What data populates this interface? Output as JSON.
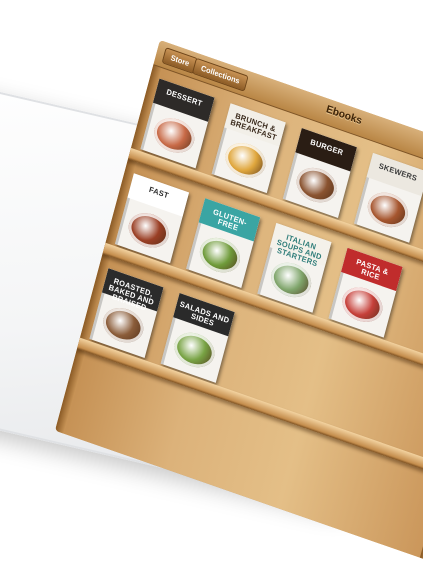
{
  "toolbar": {
    "store_label": "Store",
    "collections_label": "Collections",
    "title": "Ebooks"
  },
  "colors": {
    "wood_light": "#e4bf87",
    "wood_dark": "#8a5a25",
    "toolbar_button": "#8d5c26",
    "ipad_frame": "#f4f5f6"
  },
  "shelves": [
    {
      "books": [
        {
          "title": "DESSERT",
          "band": "#2d2a28",
          "ink": "#ffffff",
          "dish": "#c86a47"
        },
        {
          "title": "BRUNCH & BREAKFAST",
          "band": "#f2efe8",
          "ink": "#3a2a1c",
          "dish": "#e0a73d"
        },
        {
          "title": "BURGER",
          "band": "#2a1d14",
          "ink": "#ffffff",
          "dish": "#8a5330"
        },
        {
          "title": "SKEWERS",
          "band": "#ece8e0",
          "ink": "#3b3b3b",
          "dish": "#a6562f"
        }
      ]
    },
    {
      "books": [
        {
          "title": "FAST",
          "band": "#ffffff",
          "ink": "#2b2b2b",
          "dish": "#9a3f25"
        },
        {
          "title": "GLUTEN-FREE",
          "band": "#3aa5a3",
          "ink": "#ffffff",
          "dish": "#6f9b3a"
        },
        {
          "title": "ITALIAN SOUPS AND STARTERS",
          "band": "#f4f1ea",
          "ink": "#2f7d7a",
          "dish": "#7fa56b"
        },
        {
          "title": "PASTA & RICE",
          "band": "#c02c2c",
          "ink": "#ffffff",
          "dish": "#c6403a"
        }
      ]
    },
    {
      "books": [
        {
          "title": "ROASTED, BAKED AND BRAISED",
          "band": "#2b2b2b",
          "ink": "#ffffff",
          "dish": "#8b5d3a"
        },
        {
          "title": "SALADS AND SIDES",
          "band": "#2a2a2a",
          "ink": "#ffffff",
          "dish": "#78a344"
        }
      ]
    }
  ]
}
